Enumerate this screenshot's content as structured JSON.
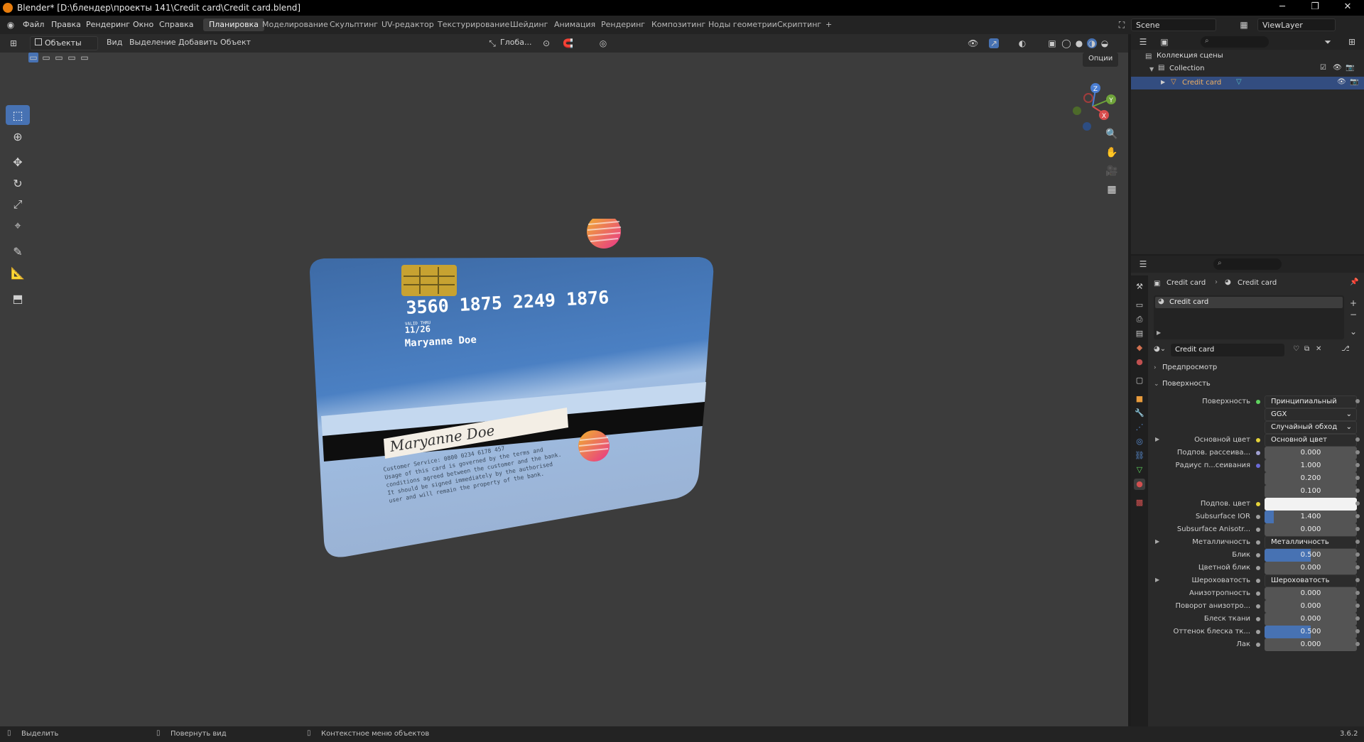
{
  "window": {
    "title": "Blender* [D:\\блендер\\проекты 141\\Credit card\\Credit card.blend]",
    "controls": [
      "─",
      "❐",
      "✕"
    ]
  },
  "menu": [
    "Файл",
    "Правка",
    "Рендеринг",
    "Окно",
    "Справка"
  ],
  "workspaces": {
    "tabs": [
      "Планировка",
      "Моделирование",
      "Скульптинг",
      "UV-редактор",
      "Текстурирование",
      "Шейдинг",
      "Анимация",
      "Рендеринг",
      "Композитинг",
      "Ноды геометрии",
      "Скриптинг"
    ],
    "active_index": 0,
    "add_label": "+"
  },
  "scene": {
    "name": "Scene",
    "view_layer": "ViewLayer"
  },
  "viewport": {
    "mode": "Объекты",
    "menus": [
      "Вид",
      "Выделение",
      "Добавить",
      "Объект"
    ],
    "orientation": "Глоба...",
    "options_label": "Опции",
    "gizmo_axes": [
      "X",
      "Y",
      "Z"
    ]
  },
  "card": {
    "number": "3560 1875 2249 1876",
    "valid_thru": "VALID THRU",
    "expiry": "11/26",
    "holder": "Maryanne Doe",
    "signature": "Maryanne Doe",
    "service_lines": [
      "Customer Service: 0800 0234 6178 457",
      "Usage of this card is governed by the terms and",
      "conditions agreed between the customer and the bank.",
      "It should be signed immediately by the authorised",
      "user and will remain the property of the bank."
    ]
  },
  "outliner": {
    "search_placeholder": "",
    "scene_collection": "Коллекция сцены",
    "collection": "Collection",
    "object": "Credit card"
  },
  "properties": {
    "breadcrumb_object": "Credit card",
    "breadcrumb_material": "Credit card",
    "slot_name": "Credit card",
    "material_name": "Credit card",
    "preview_label": "Предпросмотр",
    "surface_panel": "Поверхность",
    "version": "3.6.2",
    "rows": [
      {
        "label": "Поверхность",
        "value": "Принципиальный BSDF",
        "kind": "link",
        "dot": "#5fd35f"
      },
      {
        "label": "",
        "value": "GGX",
        "kind": "dropdown"
      },
      {
        "label": "",
        "value": "Случайный обход",
        "kind": "dropdown"
      },
      {
        "label": "Основной цвет",
        "value": "Основной цвет",
        "kind": "link",
        "dot": "#e5d33a",
        "arrow": true
      },
      {
        "label": "Подпов. рассеива...",
        "value": "0.000",
        "kind": "num",
        "dot": "#a0a0d0"
      },
      {
        "label": "Радиус п...сеивания",
        "value": "1.000",
        "kind": "num",
        "dot": "#6a6ad6"
      },
      {
        "label": "",
        "value": "0.200",
        "kind": "num"
      },
      {
        "label": "",
        "value": "0.100",
        "kind": "num"
      },
      {
        "label": "Подпов. цвет",
        "value": "",
        "kind": "color",
        "dot": "#e5d33a"
      },
      {
        "label": "Subsurface IOR",
        "value": "1.400",
        "kind": "num",
        "dot": "#a0a0a0",
        "fill": 0.1
      },
      {
        "label": "Subsurface Anisotr...",
        "value": "0.000",
        "kind": "num",
        "dot": "#a0a0a0"
      },
      {
        "label": "Металличность",
        "value": "Металличность",
        "kind": "link",
        "dot": "#a0a0a0",
        "arrow": true
      },
      {
        "label": "Блик",
        "value": "0.500",
        "kind": "num",
        "dot": "#a0a0a0",
        "fill": 0.5
      },
      {
        "label": "Цветной блик",
        "value": "0.000",
        "kind": "num",
        "dot": "#a0a0a0"
      },
      {
        "label": "Шероховатость",
        "value": "Шероховатость",
        "kind": "link",
        "dot": "#a0a0a0",
        "arrow": true
      },
      {
        "label": "Анизотропность",
        "value": "0.000",
        "kind": "num",
        "dot": "#a0a0a0"
      },
      {
        "label": "Поворот анизотро...",
        "value": "0.000",
        "kind": "num",
        "dot": "#a0a0a0"
      },
      {
        "label": "Блеск ткани",
        "value": "0.000",
        "kind": "num",
        "dot": "#a0a0a0"
      },
      {
        "label": "Оттенок блеска тк...",
        "value": "0.500",
        "kind": "num",
        "dot": "#a0a0a0",
        "fill": 0.5
      },
      {
        "label": "Лак",
        "value": "0.000",
        "kind": "num",
        "dot": "#a0a0a0"
      }
    ]
  },
  "statusbar": {
    "select": "Выделить",
    "rotate": "Повернуть вид",
    "context": "Контекстное меню объектов",
    "version": "3.6.2"
  },
  "colors": {
    "accent": "#4772b3",
    "header_bg": "#232323",
    "viewport_bg": "#3c3c3c"
  }
}
